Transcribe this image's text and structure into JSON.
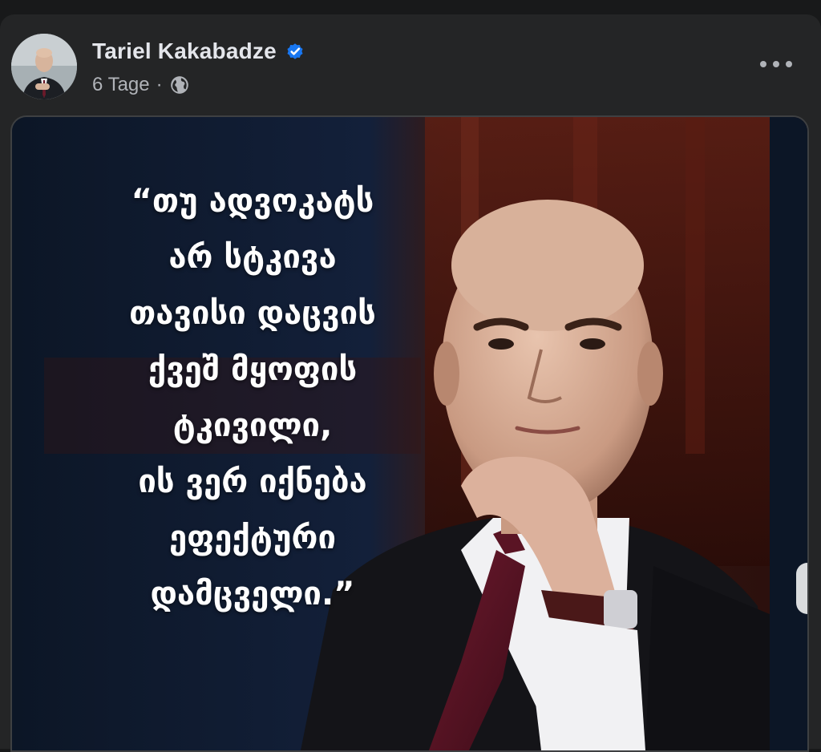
{
  "post": {
    "author_name": "Tariel Kakabadze",
    "timestamp": "6 Tage",
    "separator": "·",
    "verified_icon": "verified-badge-icon",
    "privacy_icon": "globe-icon",
    "more_icon": "more-options-icon"
  },
  "media": {
    "quote": "“თუ ადვოკატს\nარ სტკივა\nთავისი დაცვის\nქვეშ მყოფის\nტკივილი,\nის ვერ იქნება\nეფექტური\nდამცველი.”"
  },
  "colors": {
    "background": "#18191a",
    "card": "#242526",
    "primary_text": "#e4e6eb",
    "secondary_text": "#b0b3b8",
    "verified_blue": "#1877f2"
  }
}
